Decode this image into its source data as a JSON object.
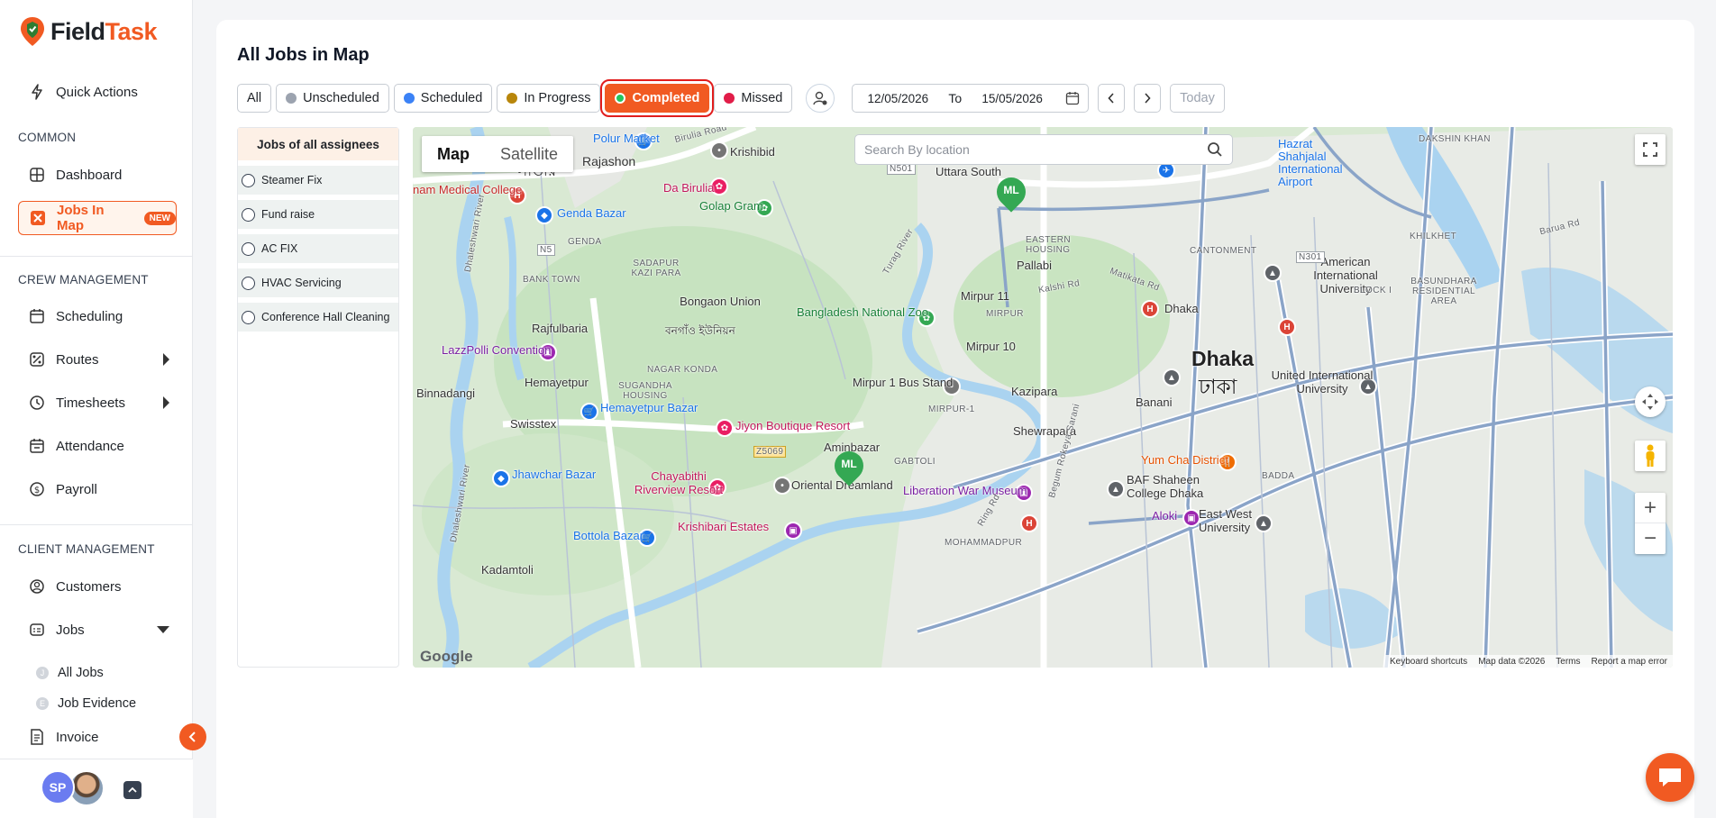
{
  "brand": {
    "name_prefix": "Field",
    "name_suffix": "Task",
    "accent": "#f15a22"
  },
  "sidebar": {
    "quick_actions": "Quick Actions",
    "sections": {
      "common": "COMMON",
      "crew": "CREW MANAGEMENT",
      "client": "CLIENT MANAGEMENT"
    },
    "items": {
      "dashboard": "Dashboard",
      "jobs_in_map": "Jobs In Map",
      "jobs_in_map_badge": "NEW",
      "scheduling": "Scheduling",
      "routes": "Routes",
      "timesheets": "Timesheets",
      "attendance": "Attendance",
      "payroll": "Payroll",
      "customers": "Customers",
      "jobs": "Jobs",
      "all_jobs": "All Jobs",
      "job_evidence": "Job Evidence",
      "invoice": "Invoice"
    },
    "user_initials": "SP"
  },
  "page": {
    "title": "All Jobs in Map"
  },
  "filters": {
    "all": "All",
    "unscheduled": "Unscheduled",
    "scheduled": "Scheduled",
    "in_progress": "In Progress",
    "completed": "Completed",
    "missed": "Missed",
    "active": "Completed",
    "colors": {
      "unscheduled": "#9ca3af",
      "scheduled": "#3b82f6",
      "in_progress": "#b8860b",
      "completed": "#22c55e",
      "missed": "#e11d48"
    }
  },
  "date_range": {
    "from": "12/05/2026",
    "to_label": "To",
    "to": "15/05/2026",
    "today": "Today"
  },
  "jobs_panel": {
    "header": "Jobs of all assignees",
    "jobs": [
      "Steamer Fix",
      "Fund raise",
      "AC FIX",
      "HVAC Servicing",
      "Conference Hall Cleaning"
    ]
  },
  "map": {
    "type_map": "Map",
    "type_satellite": "Satellite",
    "search_placeholder": "Search By location",
    "markers": [
      "ML",
      "ML"
    ],
    "google": "Google",
    "attribution": {
      "shortcuts": "Keyboard shortcuts",
      "data": "Map data ©2026",
      "terms": "Terms",
      "report": "Report a map error"
    },
    "labels": {
      "polur": "Polur Market",
      "birulia": "Birulia Road",
      "krishibid": "Krishibid",
      "rajashon": "Rajashon",
      "savar": "সাভার",
      "medical": "nam Medical College",
      "dabirulia": "Da Birulia",
      "golap": "Golap Gram",
      "genda_bazar": "Genda Bazar",
      "genda": "GENDA",
      "uttara": "Uttara South",
      "hazrat": "Hazrat Shahjalal International Airport",
      "dakshin": "DAKSHIN KHAN",
      "eastern": "EASTERN HOUSING",
      "pallabi": "Pallabi",
      "cantonment": "CANTONMENT",
      "khilkhet": "KHILKHET",
      "barua": "Barua Rd",
      "sadapur": "SADAPUR KAZI PARA",
      "bank_town": "BANK TOWN",
      "bongaon": "Bongaon Union",
      "bongaon_bn": "বনগাঁও ইউনিয়ন",
      "aiub": "American International University",
      "block": "BLOCK I",
      "bashundhara": "BASUNDHARA RESIDENTIAL AREA",
      "rajfulbaria": "Rajfulbaria",
      "zoo": "Bangladesh National Zoo",
      "mirpur11": "Mirpur 11",
      "mirpur": "MIRPUR",
      "dhaka_stn": "Dhaka",
      "lazz": "LazzPolli Convention",
      "mirpur10": "Mirpur 10",
      "nagar": "NAGAR KONDA",
      "hemayetpur": "Hemayetpur",
      "sugandha": "SUGANDHA HOUSING",
      "dhaka": "Dhaka",
      "dhaka_bn": "ঢাকা",
      "uiu": "United International University",
      "binnadangi": "Binnadangi",
      "mirpur1": "Mirpur 1 Bus Stand",
      "kazipara": "Kazipara",
      "mirpur_1": "MIRPUR-1",
      "banani": "Banani",
      "hemayetpur_bazar": "Hemayetpur Bazar",
      "swisstex": "Swisstex",
      "jiyon": "Jiyon Boutique Resort",
      "shewrapara": "Shewrapara",
      "aminbazar": "Aminbazar",
      "gabtoli": "GABTOLI",
      "yumcha": "Yum Cha District",
      "jhawchar": "Jhawchar Bazar",
      "chayabithi": "Chayabithi Riverview Resort",
      "oriental": "Oriental Dreamland",
      "liberation": "Liberation War Museum",
      "baf": "BAF Shaheen College Dhaka",
      "badda": "BADDA",
      "aloki": "Aloki",
      "ewu": "East West University",
      "krishibari": "Krishibari Estates",
      "bottola": "Bottola Bazar",
      "mohammadpur": "MOHAMMADPUR",
      "kadamtoli": "Kadamtoli",
      "dhaleshwari": "Dhaleshwari River",
      "turag": "Turag River",
      "kalshi": "Kalshi Rd",
      "matikata": "Matikata Rd",
      "ring": "Ring Rd",
      "begum": "Begum Rokeya Sarani",
      "n5": "N5",
      "n501": "N501",
      "n301": "N301",
      "z5069": "Z5069"
    }
  }
}
